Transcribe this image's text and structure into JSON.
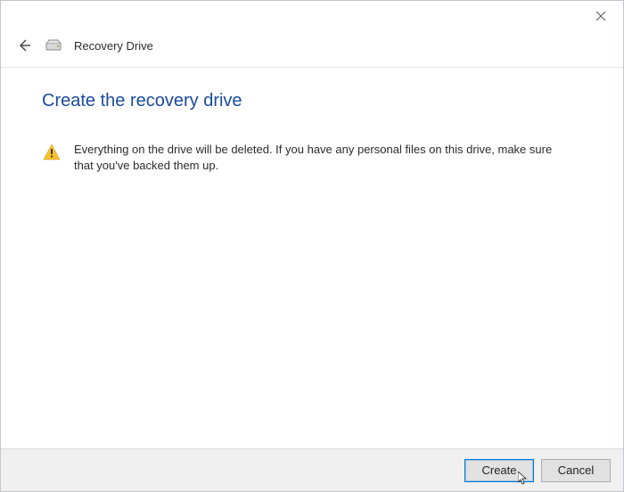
{
  "header": {
    "title": "Recovery Drive"
  },
  "page": {
    "heading": "Create the recovery drive",
    "warning_text": "Everything on the drive will be deleted. If you have any personal files on this drive, make sure that you've backed them up."
  },
  "footer": {
    "create_label": "Create",
    "cancel_label": "Cancel"
  }
}
